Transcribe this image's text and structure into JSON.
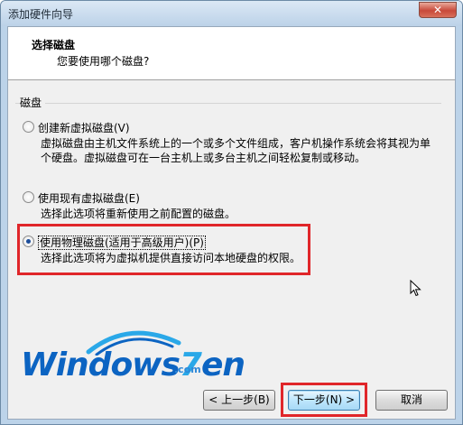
{
  "window": {
    "title": "添加硬件向导"
  },
  "header": {
    "title": "选择磁盘",
    "subtitle": "您要使用哪个磁盘?"
  },
  "group": {
    "label": "磁盘"
  },
  "options": [
    {
      "label": "创建新虚拟磁盘(V)",
      "desc_line1": "虚拟磁盘由主机文件系统上的一个或多个文件组成，客户机操作系统会将其视为单",
      "desc_line2": "个硬盘。虚拟磁盘可在一台主机上或多台主机之间轻松复制或移动。",
      "selected": false
    },
    {
      "label": "使用现有虚拟磁盘(E)",
      "desc_line1": "选择此选项将重新使用之前配置的磁盘。",
      "selected": false
    },
    {
      "label": "使用物理磁盘(适用于高级用户)(P)",
      "desc_line1": "选择此选项将为虚拟机提供直接访问本地硬盘的权限。",
      "selected": true
    }
  ],
  "logo": {
    "main": "Windows",
    "seven": "7",
    "en": "en",
    "domain": ".com"
  },
  "buttons": {
    "back": "< 上一步(B)",
    "next": "下一步(N) >",
    "cancel": "取消"
  },
  "colors": {
    "highlight": "#e0262a",
    "accent": "#1b4d9a"
  }
}
